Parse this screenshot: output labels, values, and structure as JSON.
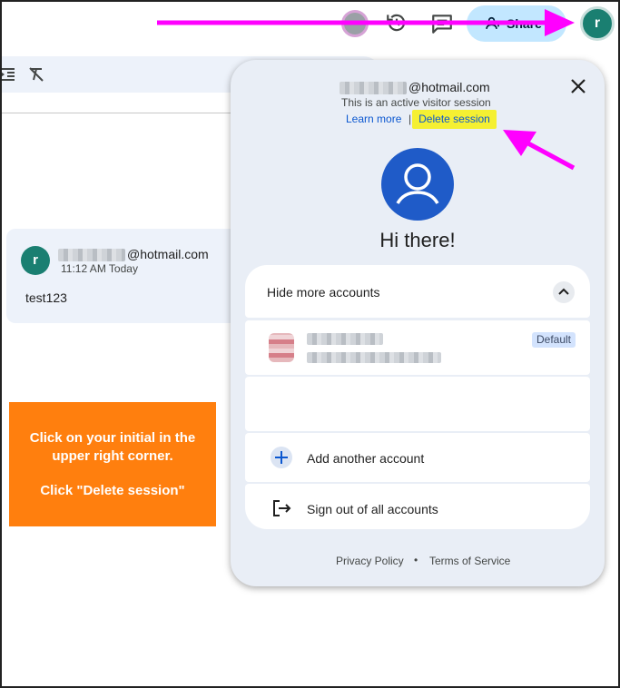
{
  "topbar": {
    "share_label": "Share",
    "profile_initial": "r"
  },
  "comment": {
    "avatar_initial": "r",
    "email_domain": "@hotmail.com",
    "time": "11:12 AM Today",
    "body": "test123"
  },
  "instructions": {
    "line1": "Click on your initial in the upper right corner.",
    "line2": "Click \"Delete session\""
  },
  "popup": {
    "email_domain": "@hotmail.com",
    "visitor_text": "This is an active visitor session",
    "learn_more": "Learn more",
    "separator": "|",
    "delete_session": "Delete session",
    "greeting": "Hi there!",
    "hide_accounts_label": "Hide more accounts",
    "default_badge": "Default",
    "add_account_label": "Add another account",
    "sign_out_label": "Sign out of all accounts",
    "privacy_policy": "Privacy Policy",
    "footer_dot": "•",
    "terms": "Terms of Service"
  },
  "colors": {
    "annotation_arrow": "#ff00ff",
    "highlight": "#f5f032",
    "instruction_bg": "#ff7f0e",
    "avatar_teal": "#1a7f71",
    "link_blue": "#0b57d0"
  },
  "icons": [
    "history-icon",
    "comment-icon",
    "share-icon",
    "indent-icon",
    "clear-format-icon",
    "close-icon",
    "account-circle-icon",
    "chevron-up-icon",
    "plus-icon",
    "sign-out-icon"
  ]
}
